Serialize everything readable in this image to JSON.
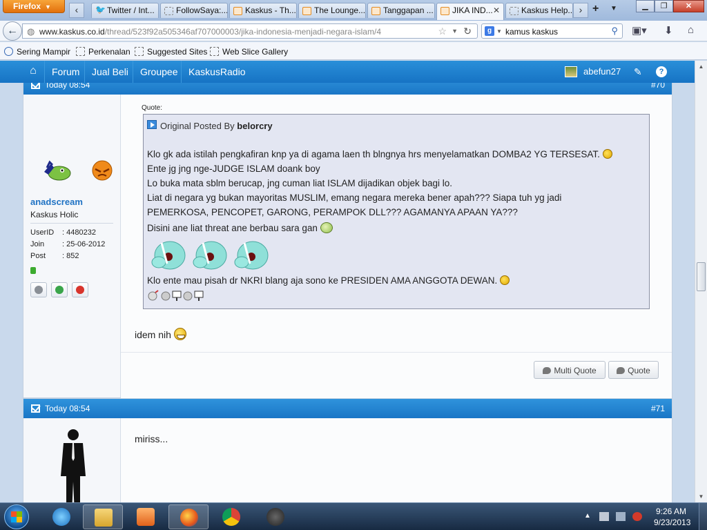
{
  "browser": {
    "menu_label": "Firefox",
    "tabs": [
      {
        "title": "Twitter / Int...",
        "icon": "twitter-icon"
      },
      {
        "title": "FollowSaya:...",
        "icon": "page-icon"
      },
      {
        "title": "Kaskus - Th...",
        "icon": "kaskus-icon"
      },
      {
        "title": "The Lounge...",
        "icon": "kaskus-icon"
      },
      {
        "title": "Tanggapan ...",
        "icon": "kaskus-icon"
      },
      {
        "title": "JIKA IND...",
        "icon": "kaskus-icon"
      },
      {
        "title": "Kaskus Help...",
        "icon": "page-icon"
      }
    ],
    "url": {
      "host": "www.kaskus.co.id",
      "path": "/thread/523f92a505346af707000003/jika-indonesia-menjadi-negara-islam/4"
    },
    "search_value": "kamus kaskus",
    "bookmarks": [
      "Sering Mampir",
      "Perkenalan",
      "Suggested Sites",
      "Web Slice Gallery"
    ]
  },
  "site_nav": {
    "items": [
      "Forum",
      "Jual Beli",
      "Groupee",
      "KaskusRadio"
    ],
    "username": "abefun27"
  },
  "post70": {
    "time": "Today 08:54",
    "number": "#70",
    "username": "anadscream",
    "rank": "Kaskus Holic",
    "info": [
      {
        "label": "UserID",
        "value": ": 4480232"
      },
      {
        "label": "Join",
        "value": ": 25-06-2012"
      },
      {
        "label": "Post",
        "value": ": 852"
      }
    ],
    "quote_label": "Quote:",
    "quote_prefix": "Original Posted By",
    "quote_author": "belorcry",
    "quote_lines": [
      "Klo gk ada istilah pengkafiran knp ya di agama laen th blngnya hrs menyelamatkan DOMBA2 YG TERSESAT.",
      "Ente jg jng nge-JUDGE ISLAM doank boy",
      "Lo buka mata sblm berucap, jng cuman liat ISLAM dijadikan objek bagi lo.",
      "Liat di negara yg bukan mayoritas MUSLIM, emang negara mereka bener apah??? Siapa tuh yg jadi",
      "PEMERKOSA, PENCOPET, GARONG, PERAMPOK DLL??? AGAMANYA APAAN YA???",
      "Disini ane liat threat ane berbau sara gan",
      "Klo ente mau pisah dr NKRI blang aja sono ke PRESIDEN AMA ANGGOTA DEWAN."
    ],
    "reply": "idem nih",
    "buttons": {
      "multi_quote": "Multi Quote",
      "quote": "Quote"
    }
  },
  "post71": {
    "time": "Today 08:54",
    "number": "#71",
    "text": "miriss..."
  },
  "taskbar": {
    "time": "9:26 AM",
    "date": "9/23/2013"
  },
  "colors": {
    "site_nav": "#1673c4",
    "post_header": "#1a76c6",
    "username_link": "#1f72c3"
  }
}
